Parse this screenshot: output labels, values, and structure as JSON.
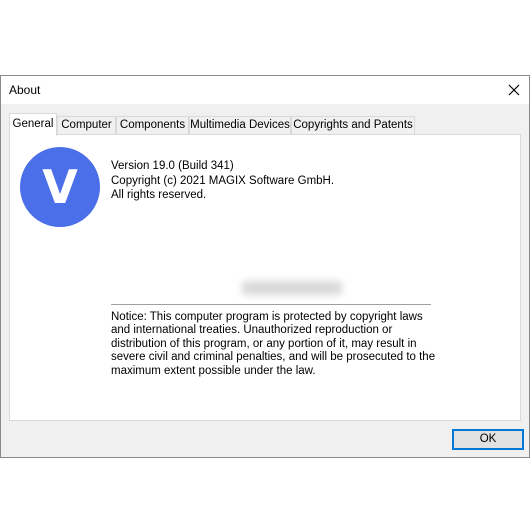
{
  "window": {
    "title": "About",
    "close_icon": "close-icon"
  },
  "tabs": [
    {
      "label": "General",
      "active": true
    },
    {
      "label": "Computer",
      "active": false
    },
    {
      "label": "Components",
      "active": false
    },
    {
      "label": "Multimedia Devices",
      "active": false
    },
    {
      "label": "Copyrights and Patents",
      "active": false
    }
  ],
  "general": {
    "logo_letter": "V",
    "logo_color": "#4a6fe8",
    "version": "Version 19.0 (Build 341)",
    "copyright": "Copyright (c) 2021 MAGIX Software GmbH.",
    "rights": "All rights reserved.",
    "notice": "Notice: This computer program is protected by copyright laws and international treaties. Unauthorized reproduction or distribution of this program, or any portion of it, may result in severe civil and criminal penalties, and will be prosecuted to the maximum extent possible under the law."
  },
  "buttons": {
    "ok_label": "OK",
    "accent": "#0078d7"
  }
}
